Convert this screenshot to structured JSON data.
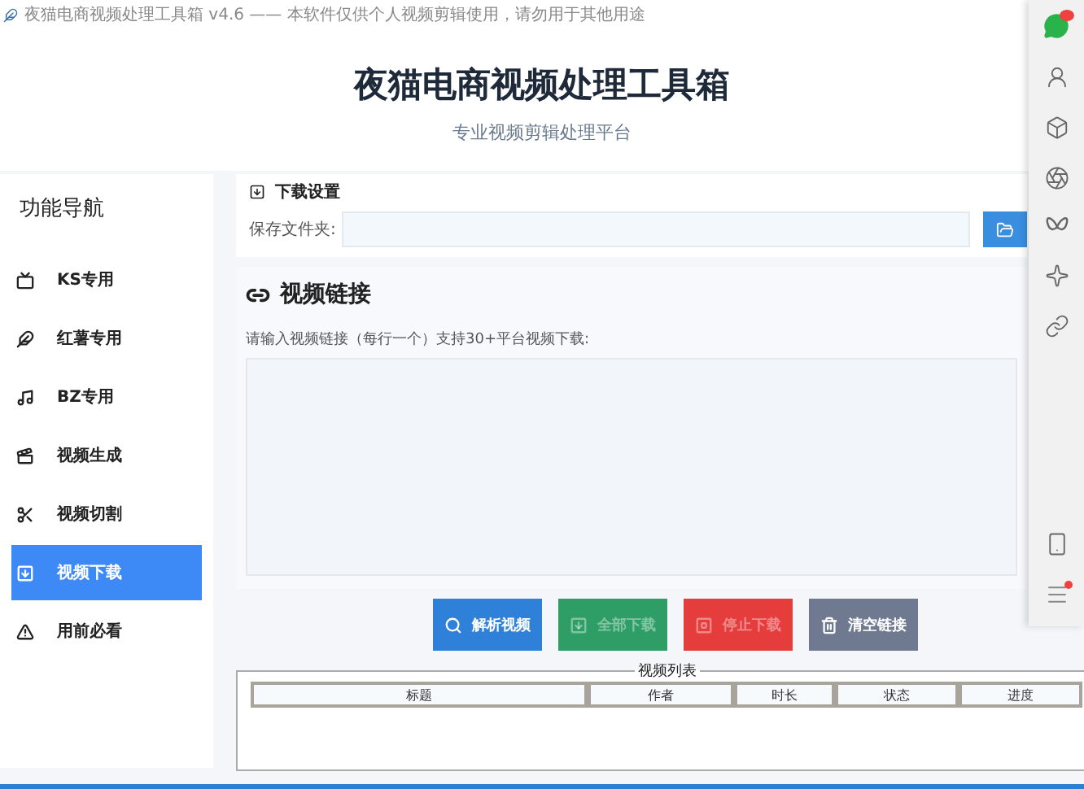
{
  "window": {
    "title": "夜猫电商视频处理工具箱 v4.6 —— 本软件仅供个人视频剪辑使用，请勿用于其他用途"
  },
  "header": {
    "title": "夜猫电商视频处理工具箱",
    "subtitle": "专业视频剪辑处理平台"
  },
  "sidebar": {
    "title": "功能导航",
    "items": [
      {
        "label": "KS专用",
        "kind": "tv",
        "selected": false
      },
      {
        "label": "红薯专用",
        "kind": "leaf",
        "selected": false
      },
      {
        "label": "BZ专用",
        "kind": "music",
        "selected": false
      },
      {
        "label": "视频生成",
        "kind": "clapper",
        "selected": false
      },
      {
        "label": "视频切割",
        "kind": "scissors",
        "selected": false
      },
      {
        "label": "视频下载",
        "kind": "download",
        "selected": true
      },
      {
        "label": "用前必看",
        "kind": "alert",
        "selected": false
      }
    ]
  },
  "download_settings": {
    "title": "下载设置",
    "folder_label": "保存文件夹:"
  },
  "links": {
    "title": "视频链接",
    "hint": "请输入视频链接（每行一个）支持30+平台视频下载:"
  },
  "actions": [
    {
      "label": "解析视频",
      "kind": "parse",
      "disabled": false
    },
    {
      "label": "全部下载",
      "kind": "download",
      "disabled": true
    },
    {
      "label": "停止下载",
      "kind": "stop",
      "disabled": true
    },
    {
      "label": "清空链接",
      "kind": "clear",
      "disabled": false
    }
  ],
  "video_list": {
    "title": "视频列表",
    "columns": [
      "标题",
      "作者",
      "时长",
      "状态",
      "进度"
    ]
  }
}
